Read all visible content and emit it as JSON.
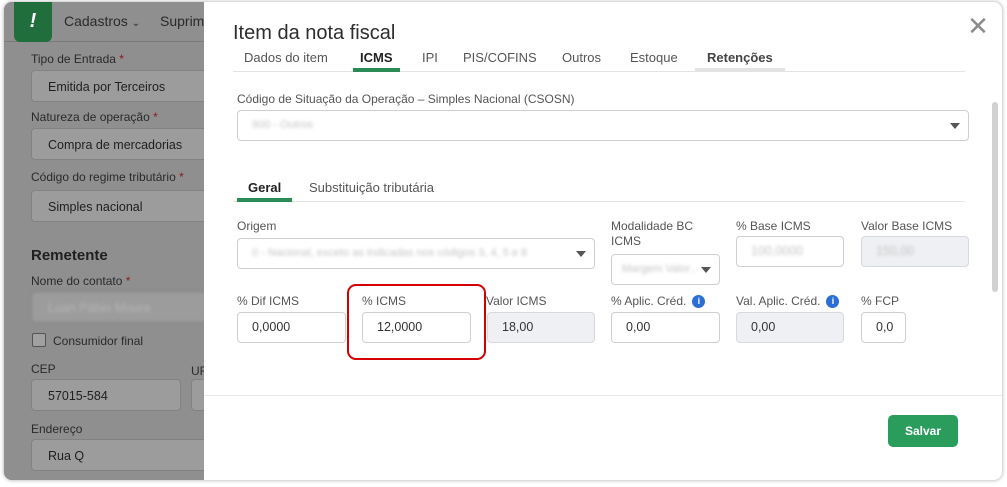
{
  "background": {
    "menu": [
      {
        "label": "Cadastros",
        "chevron": "chevron-down-icon"
      },
      {
        "label": "Suprim"
      }
    ],
    "fields": [
      {
        "label": "Tipo de Entrada",
        "value": "Emitida por Terceiros"
      },
      {
        "label": "Natureza de operação",
        "value": "Compra de mercadorias"
      },
      {
        "label": "Código do regime tributário",
        "value": "Simples nacional"
      }
    ],
    "required_mark": "*",
    "section_title": "Remetente",
    "contact_label": "Nome do contato",
    "contact_value": "Luan Pábio Moura",
    "checkbox_label": "Consumidor final",
    "cep_label": "CEP",
    "cep_value": "57015-584",
    "uf_label": "UF",
    "address_label": "Endereço",
    "address_value": "Rua Q"
  },
  "modal": {
    "title": "Item da nota fiscal",
    "close_icon": "close-icon",
    "tabs": [
      {
        "label": "Dados do item"
      },
      {
        "label": "ICMS"
      },
      {
        "label": "IPI"
      },
      {
        "label": "PIS/COFINS"
      },
      {
        "label": "Outros"
      },
      {
        "label": "Estoque"
      },
      {
        "label": "Retenções"
      }
    ],
    "active_tab": "ICMS",
    "csosn": {
      "label": "Código de Situação da Operação – Simples Nacional (CSOSN)",
      "value": "900 - Outros"
    },
    "subtabs": [
      {
        "label": "Geral"
      },
      {
        "label": "Substituição tributária"
      }
    ],
    "active_subtab": "Geral",
    "origem": {
      "label": "Origem",
      "value": "0 - Nacional, exceto as indicadas nos códigos 3, 4, 5 e 8"
    },
    "modalidade": {
      "label": "Modalidade BC ICMS",
      "value": "Margem Valor Agregado"
    },
    "base_icms": {
      "label": "% Base ICMS",
      "value": "100,0000"
    },
    "valor_base_icms": {
      "label": "Valor Base ICMS",
      "value": "150,00"
    },
    "dif_icms": {
      "label": "% Dif ICMS",
      "value": "0,0000"
    },
    "icms": {
      "label": "% ICMS",
      "value": "12,0000"
    },
    "valor_icms": {
      "label": "Valor ICMS",
      "value": "18,00"
    },
    "aplic_cred": {
      "label": "% Aplic. Créd.",
      "value": "0,00",
      "icon": "info-icon"
    },
    "val_aplic_cred": {
      "label": "Val. Aplic. Créd.",
      "value": "0,00",
      "icon": "info-icon"
    },
    "fcp": {
      "label": "% FCP",
      "value": "0,0"
    },
    "info_glyph": "i",
    "save_label": "Salvar"
  },
  "colors": {
    "accent": "#2a9d5c",
    "highlight": "#d40000",
    "info": "#2b6fd6"
  }
}
